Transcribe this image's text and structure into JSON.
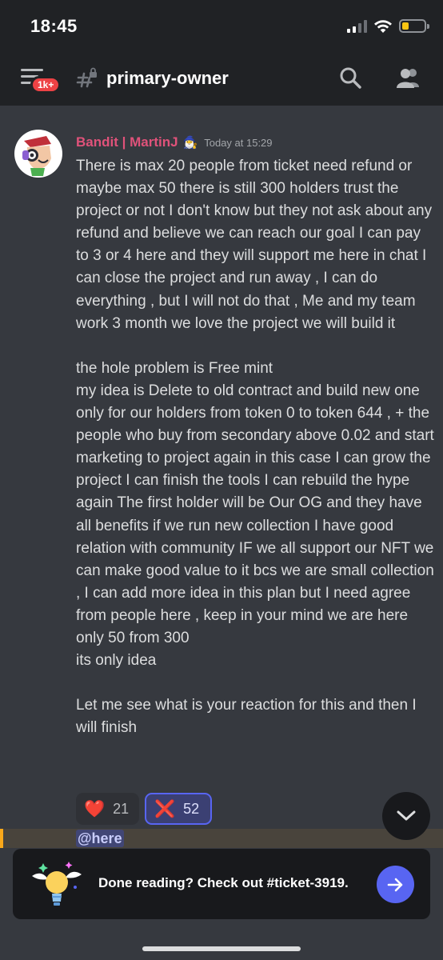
{
  "status_bar": {
    "time": "18:45",
    "battery_level": 0.25,
    "battery_color": "#f9c513"
  },
  "header": {
    "unread_badge": "1k+",
    "channel_name": "primary-owner",
    "channel_icon": "locked-hash-icon"
  },
  "message": {
    "author": "Bandit | MartinJ",
    "author_color": "#e0527a",
    "author_emoji": "🧙‍♂️",
    "timestamp": "Today at 15:29",
    "paragraphs": [
      "There is max 20 people from ticket need refund or maybe max 50 there is still 300 holders trust the project or not I don't know but they not ask about any refund and believe we can reach our goal I can pay to 3 or 4 here and they will support me here in chat I can close the project and run away , I can do everything , but I will not do that , Me and my team work 3 month we love the project we will build it",
      "",
      "the hole problem is Free mint",
      "my  idea is Delete to old contract and build new one only for our holders from token 0 to token 644 , + the people who buy from secondary above 0.02 and start marketing to project again in this case I can grow the project I can finish the tools I can rebuild the hype again The first holder will be Our OG and they have all benefits if we run new collection I have good relation with community IF we all support our NFT we can make good value to it bcs we are small collection , I can add more idea in this plan but I need agree from people here , keep in your mind we are here only 50 from 300",
      "its only idea",
      "",
      "Let me see what is your reaction for this and then I will finish"
    ],
    "reactions": [
      {
        "emoji": "❤️",
        "count": "21",
        "reacted": false
      },
      {
        "emoji": "❌",
        "count": "52",
        "reacted": true
      }
    ]
  },
  "next_message": {
    "mention": "@here"
  },
  "banner": {
    "text": "Done reading? Check out #ticket-3919.",
    "accent": "#5865f2"
  }
}
